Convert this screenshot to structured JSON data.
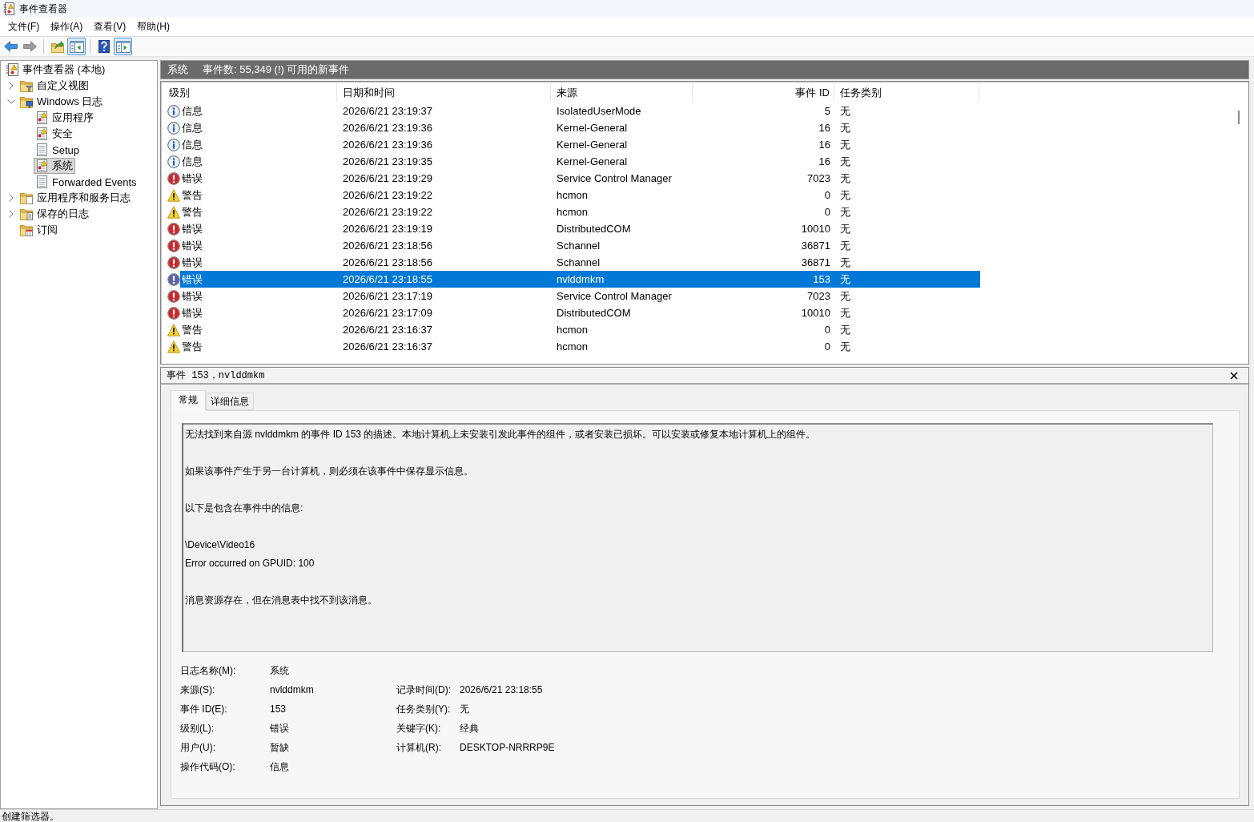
{
  "window": {
    "title": "事件查看器"
  },
  "menu": [
    "文件(F)",
    "操作(A)",
    "查看(V)",
    "帮助(H)"
  ],
  "toolbar": [
    [
      {
        "kind": "back",
        "disabled": false,
        "pressed": false
      },
      {
        "kind": "forward",
        "disabled": true,
        "pressed": false
      }
    ],
    [
      {
        "kind": "up",
        "disabled": false,
        "pressed": false
      },
      {
        "kind": "tree-pane",
        "disabled": false,
        "pressed": true
      }
    ],
    [
      {
        "kind": "help",
        "disabled": false,
        "pressed": false
      },
      {
        "kind": "action-pane",
        "disabled": false,
        "pressed": true
      }
    ]
  ],
  "tree": [
    {
      "label": "事件查看器 (本地)",
      "kind": "viewer",
      "selected": false,
      "children": [
        {
          "label": "自定义视图",
          "kind": "filter-folder",
          "expanded": false,
          "selected": false
        },
        {
          "label": "Windows 日志",
          "kind": "monitor-folder",
          "expanded": true,
          "selected": false,
          "children": [
            {
              "label": "应用程序",
              "kind": "alert-log",
              "selected": false
            },
            {
              "label": "安全",
              "kind": "alert-log",
              "selected": false
            },
            {
              "label": "Setup",
              "kind": "log",
              "selected": false
            },
            {
              "label": "系统",
              "kind": "alert-log",
              "selected": true
            },
            {
              "label": "Forwarded Events",
              "kind": "log",
              "selected": false
            }
          ]
        },
        {
          "label": "应用程序和服务日志",
          "kind": "folder",
          "expanded": false,
          "selected": false
        },
        {
          "label": "保存的日志",
          "kind": "document-folder",
          "expanded": false,
          "selected": false
        },
        {
          "label": "订阅",
          "kind": "calendar-folder",
          "selected": false
        }
      ]
    }
  ],
  "log_header": {
    "name": "系统",
    "summary": "事件数: 55,349 (!) 可用的新事件"
  },
  "events": {
    "columns": [
      "级别",
      "日期和时间",
      "来源",
      "事件 ID",
      "任务类别"
    ],
    "rows": [
      {
        "kind": "info",
        "severity": "信息",
        "date_time": "2026/6/21 23:19:37",
        "source": "IsolatedUserMode",
        "event_id": "5",
        "task_category": "无",
        "selected": false
      },
      {
        "kind": "info",
        "severity": "信息",
        "date_time": "2026/6/21 23:19:36",
        "source": "Kernel-General",
        "event_id": "16",
        "task_category": "无",
        "selected": false
      },
      {
        "kind": "info",
        "severity": "信息",
        "date_time": "2026/6/21 23:19:36",
        "source": "Kernel-General",
        "event_id": "16",
        "task_category": "无",
        "selected": false
      },
      {
        "kind": "info",
        "severity": "信息",
        "date_time": "2026/6/21 23:19:35",
        "source": "Kernel-General",
        "event_id": "16",
        "task_category": "无",
        "selected": false
      },
      {
        "kind": "error",
        "severity": "错误",
        "date_time": "2026/6/21 23:19:29",
        "source": "Service Control Manager",
        "event_id": "7023",
        "task_category": "无",
        "selected": false
      },
      {
        "kind": "warning",
        "severity": "警告",
        "date_time": "2026/6/21 23:19:22",
        "source": "hcmon",
        "event_id": "0",
        "task_category": "无",
        "selected": false
      },
      {
        "kind": "warning",
        "severity": "警告",
        "date_time": "2026/6/21 23:19:22",
        "source": "hcmon",
        "event_id": "0",
        "task_category": "无",
        "selected": false
      },
      {
        "kind": "error",
        "severity": "错误",
        "date_time": "2026/6/21 23:19:19",
        "source": "DistributedCOM",
        "event_id": "10010",
        "task_category": "无",
        "selected": false
      },
      {
        "kind": "error",
        "severity": "错误",
        "date_time": "2026/6/21 23:18:56",
        "source": "Schannel",
        "event_id": "36871",
        "task_category": "无",
        "selected": false
      },
      {
        "kind": "error",
        "severity": "错误",
        "date_time": "2026/6/21 23:18:56",
        "source": "Schannel",
        "event_id": "36871",
        "task_category": "无",
        "selected": false
      },
      {
        "kind": "error",
        "severity": "错误",
        "date_time": "2026/6/21 23:18:55",
        "source": "nvlddmkm",
        "event_id": "153",
        "task_category": "无",
        "selected": true
      },
      {
        "kind": "error",
        "severity": "错误",
        "date_time": "2026/6/21 23:17:19",
        "source": "Service Control Manager",
        "event_id": "7023",
        "task_category": "无",
        "selected": false
      },
      {
        "kind": "error",
        "severity": "错误",
        "date_time": "2026/6/21 23:17:09",
        "source": "DistributedCOM",
        "event_id": "10010",
        "task_category": "无",
        "selected": false
      },
      {
        "kind": "warning",
        "severity": "警告",
        "date_time": "2026/6/21 23:16:37",
        "source": "hcmon",
        "event_id": "0",
        "task_category": "无",
        "selected": false
      },
      {
        "kind": "warning",
        "severity": "警告",
        "date_time": "2026/6/21 23:16:37",
        "source": "hcmon",
        "event_id": "0",
        "task_category": "无",
        "selected": false
      }
    ]
  },
  "detail": {
    "title": "事件 153，nvlddmkm",
    "tabs": [
      {
        "label": "常规",
        "selected": true
      },
      {
        "label": "详细信息",
        "selected": false
      }
    ],
    "description": [
      [
        "无法找到来自源 nvlddmkm 的事件 ID 153 的描述。本地计算机上未安装引发此事件的组件，或者安装已损坏。可以安装或修复本地计算机上的组件。"
      ],
      [
        "如果该事件产生于另一台计算机，则必须在该事件中保存显示信息。"
      ],
      [
        "以下是包含在事件中的信息:"
      ],
      [
        "\\Device\\Video16",
        "Error occurred on GPUID: 100"
      ],
      [
        "消息资源存在，但在消息表中找不到该消息。"
      ]
    ],
    "properties": [
      [
        {
          "label": "日志名称(M):",
          "value": "系统"
        }
      ],
      [
        {
          "label": "来源(S):",
          "value": "nvlddmkm"
        },
        {
          "label": "记录时间(D):",
          "value": "2026/6/21 23:18:55"
        }
      ],
      [
        {
          "label": "事件 ID(E):",
          "value": "153"
        },
        {
          "label": "任务类别(Y):",
          "value": "无"
        }
      ],
      [
        {
          "label": "级别(L):",
          "value": "错误"
        },
        {
          "label": "关键字(K):",
          "value": "经典"
        }
      ],
      [
        {
          "label": "用户(U):",
          "value": "暂缺"
        },
        {
          "label": "计算机(R):",
          "value": "DESKTOP-NRRRP9E"
        }
      ],
      [
        {
          "label": "操作代码(O):",
          "value": "信息"
        }
      ]
    ]
  },
  "status_bar": "创建筛选器。"
}
